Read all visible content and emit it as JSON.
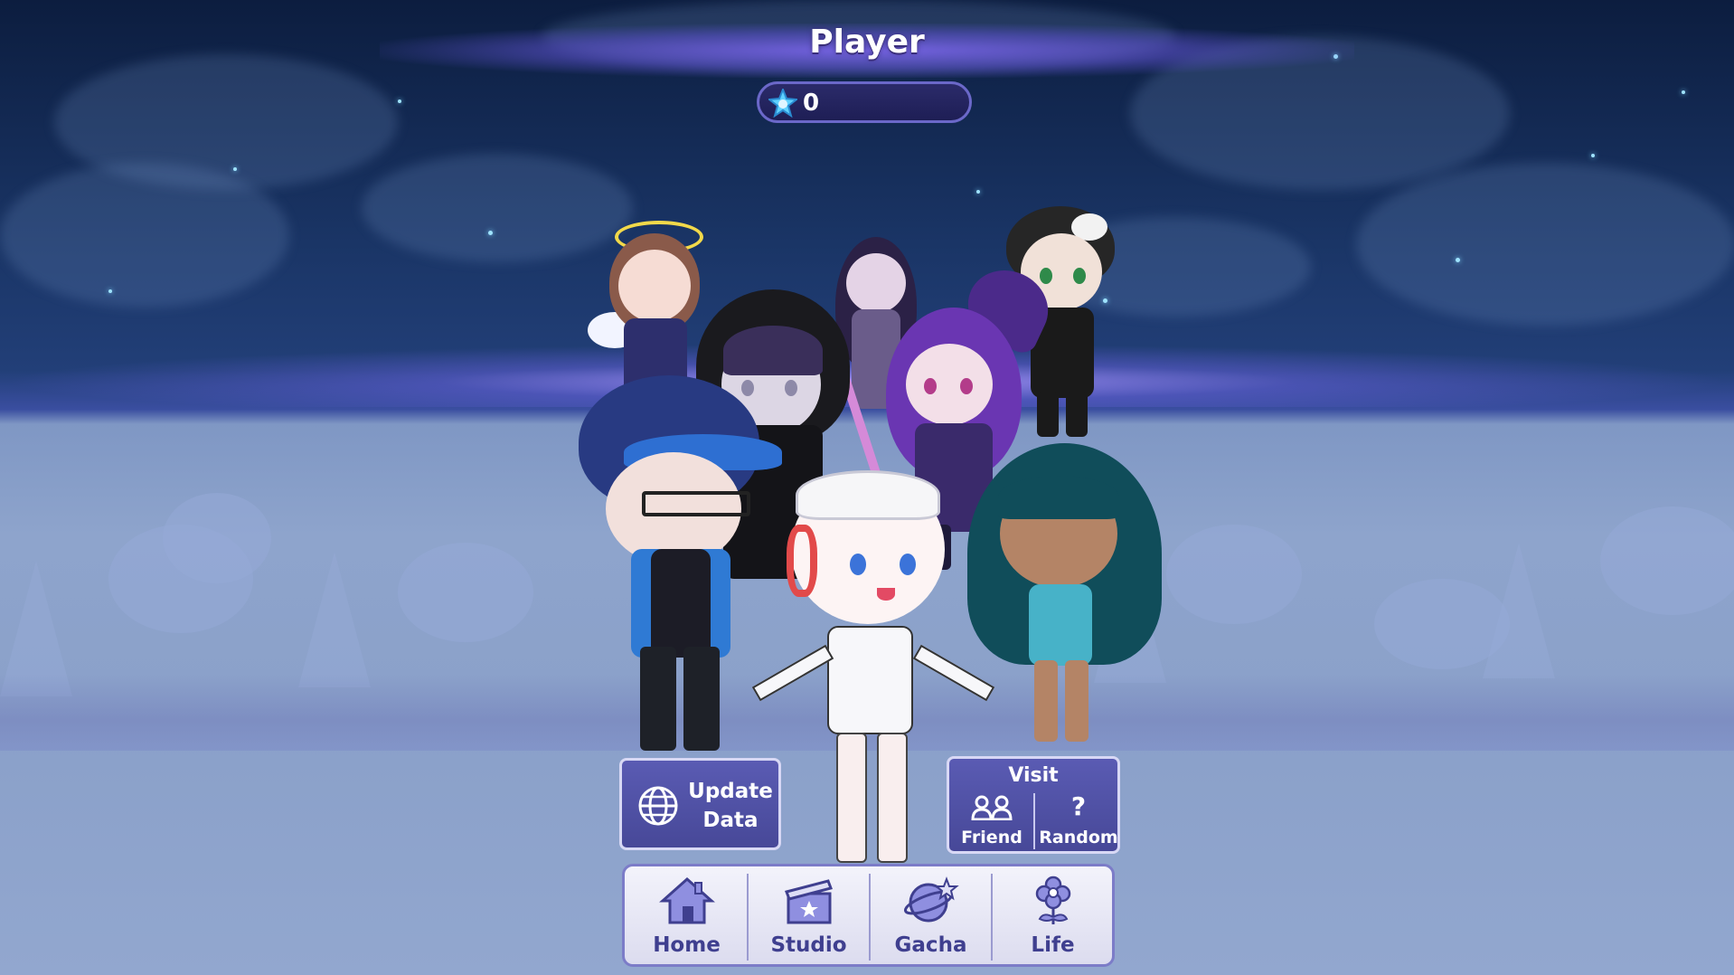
{
  "header": {
    "player_name": "Player",
    "currency": {
      "icon": "star-gem-icon",
      "value": "0"
    }
  },
  "actions": {
    "update_data_label": "Update Data",
    "visit": {
      "title": "Visit",
      "friend_label": "Friend",
      "random_label": "Random"
    }
  },
  "nav": {
    "items": [
      {
        "label": "Home",
        "icon": "house-icon"
      },
      {
        "label": "Studio",
        "icon": "clapperboard-icon"
      },
      {
        "label": "Gacha",
        "icon": "gacha-planet-icon"
      },
      {
        "label": "Life",
        "icon": "flower-icon"
      }
    ]
  },
  "colors": {
    "panel": "#4f50a6",
    "panel_border": "#d8d8f5",
    "nav_text": "#3f3f8f",
    "sky": "#1a3566",
    "ground": "#8ea4cc"
  }
}
